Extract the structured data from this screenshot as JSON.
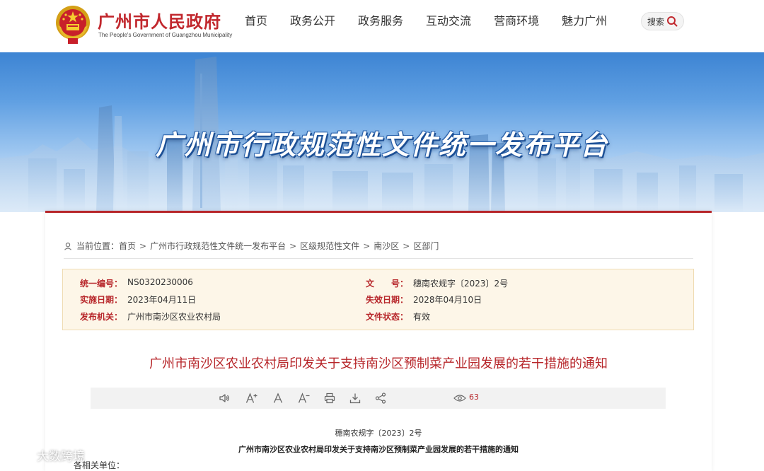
{
  "header": {
    "site_title": "广州市人民政府",
    "site_subtitle": "The People's Government of Guangzhou Municipality",
    "nav": [
      "首页",
      "政务公开",
      "政务服务",
      "互动交流",
      "营商环境",
      "魅力广州"
    ],
    "search_label": "搜索"
  },
  "banner": {
    "title": "广州市行政规范性文件统一发布平台"
  },
  "breadcrumb": {
    "label": "当前位置：",
    "items": [
      "首页",
      "广州市行政规范性文件统一发布平台",
      "区级规范性文件",
      "南沙区",
      "区部门"
    ],
    "separator": ">"
  },
  "meta": {
    "unified_no_label": "统一编号：",
    "unified_no": "NS0320230006",
    "doc_no_label": "文　　号：",
    "doc_no": "穗南农规字〔2023〕2号",
    "effective_label": "实施日期：",
    "effective": "2023年04月11日",
    "expiry_label": "失效日期：",
    "expiry": "2028年04月10日",
    "issuer_label": "发布机关：",
    "issuer": "广州市南沙区农业农村局",
    "status_label": "文件状态：",
    "status": "有效"
  },
  "document": {
    "title": "广州市南沙区农业农村局印发关于支持南沙区预制菜产业园发展的若干措施的通知",
    "number": "穗南农规字〔2023〕2号",
    "subtitle": "广州市南沙区农业农村局印发关于支持南沙区预制菜产业园发展的若干措施的通知",
    "salutation": "各相关单位："
  },
  "toolbar": {
    "view_count": "63"
  },
  "watermark": {
    "text": "大数跨境"
  },
  "colors": {
    "brand_red": "#b7262a",
    "meta_bg": "#fdf6e8",
    "banner_blue": "#3d84d3"
  }
}
